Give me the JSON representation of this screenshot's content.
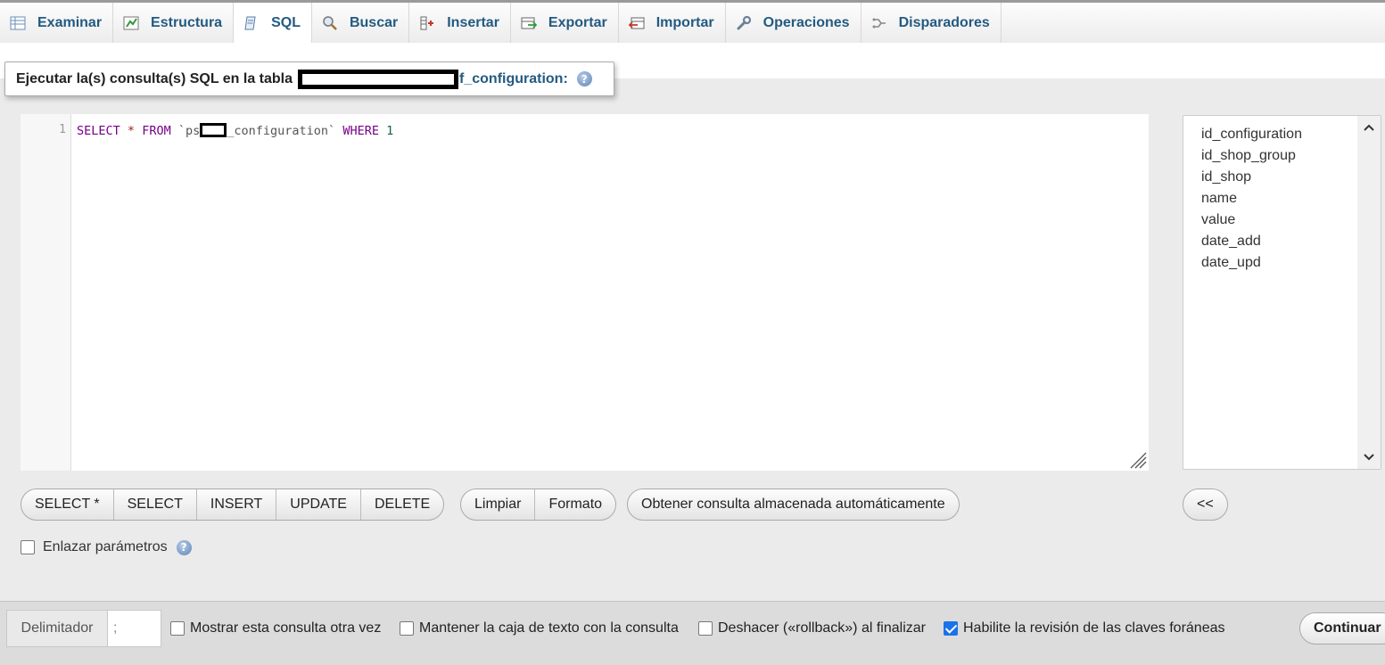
{
  "tabs": [
    {
      "label": "Examinar",
      "icon": "table-browse-icon",
      "active": false
    },
    {
      "label": "Estructura",
      "icon": "structure-icon",
      "active": false
    },
    {
      "label": "SQL",
      "icon": "sql-icon",
      "active": true
    },
    {
      "label": "Buscar",
      "icon": "search-icon",
      "active": false
    },
    {
      "label": "Insertar",
      "icon": "insert-icon",
      "active": false
    },
    {
      "label": "Exportar",
      "icon": "export-icon",
      "active": false
    },
    {
      "label": "Importar",
      "icon": "import-icon",
      "active": false
    },
    {
      "label": "Operaciones",
      "icon": "wrench-icon",
      "active": false
    },
    {
      "label": "Disparadores",
      "icon": "triggers-icon",
      "active": false
    }
  ],
  "legend": {
    "prefix": "Ejecutar la(s) consulta(s) SQL en la tabla",
    "table_suffix": "f_configuration:"
  },
  "editor": {
    "line_number": "1",
    "query": {
      "kw_select": "SELECT",
      "star": "*",
      "kw_from": "FROM",
      "tick_open": "`ps",
      "table_rest": "_configuration`",
      "kw_where": "WHERE",
      "num": "1"
    }
  },
  "columns": [
    "id_configuration",
    "id_shop_group",
    "id_shop",
    "name",
    "value",
    "date_add",
    "date_upd"
  ],
  "query_buttons": [
    "SELECT *",
    "SELECT",
    "INSERT",
    "UPDATE",
    "DELETE"
  ],
  "tool_buttons": [
    "Limpiar",
    "Formato"
  ],
  "autosave_button": "Obtener consulta almacenada automáticamente",
  "insert_column_button": "<<",
  "bind_params": {
    "label": "Enlazar parámetros",
    "checked": false
  },
  "footer": {
    "delimiter_label": "Delimitador",
    "delimiter_value": ";",
    "options": [
      {
        "label": "Mostrar esta consulta otra vez",
        "checked": false
      },
      {
        "label": "Mantener la caja de texto con la consulta",
        "checked": false
      },
      {
        "label": "Deshacer («rollback») al finalizar",
        "checked": false
      },
      {
        "label": "Habilite la revisión de las claves foráneas",
        "checked": true
      }
    ],
    "submit_label": "Continuar"
  },
  "colors": {
    "link": "#235a81",
    "accent": "#1a73e8"
  }
}
